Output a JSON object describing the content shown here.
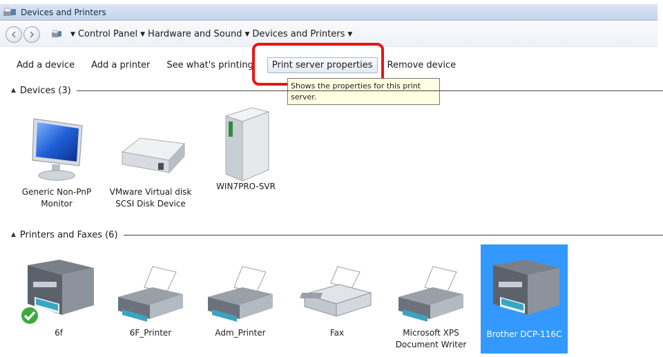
{
  "window": {
    "title": "Devices and Printers"
  },
  "address": {
    "crumbs": [
      "Control Panel",
      "Hardware and Sound",
      "Devices and Printers"
    ]
  },
  "toolbar": {
    "add_device": "Add a device",
    "add_printer": "Add a printer",
    "see_printing": "See what's printing",
    "print_server_properties": "Print server properties",
    "remove_device": "Remove device"
  },
  "tooltip": {
    "text": "Shows the properties for this print server."
  },
  "groups": {
    "devices": {
      "label": "Devices (3)",
      "items": [
        {
          "label": "Generic Non-PnP Monitor",
          "icon": "monitor-icon"
        },
        {
          "label": "VMware Virtual disk SCSI Disk Device",
          "icon": "hard-disk-icon"
        },
        {
          "label": "WIN7PRO-SVR",
          "icon": "computer-tower-icon"
        }
      ]
    },
    "printers": {
      "label": "Printers and Faxes (6)",
      "items": [
        {
          "label": "6f",
          "icon": "multifunction-printer-icon",
          "default": true
        },
        {
          "label": "6F_Printer",
          "icon": "printer-icon"
        },
        {
          "label": "Adm_Printer",
          "icon": "printer-icon"
        },
        {
          "label": "Fax",
          "icon": "fax-icon"
        },
        {
          "label": "Microsoft XPS Document Writer",
          "icon": "printer-icon"
        },
        {
          "label": "Brother DCP-116C",
          "icon": "multifunction-printer-icon",
          "selected": true
        }
      ]
    }
  },
  "colors": {
    "highlight": "#e8141b",
    "selection": "#3399ff",
    "tooltip": "#ffffe1"
  }
}
